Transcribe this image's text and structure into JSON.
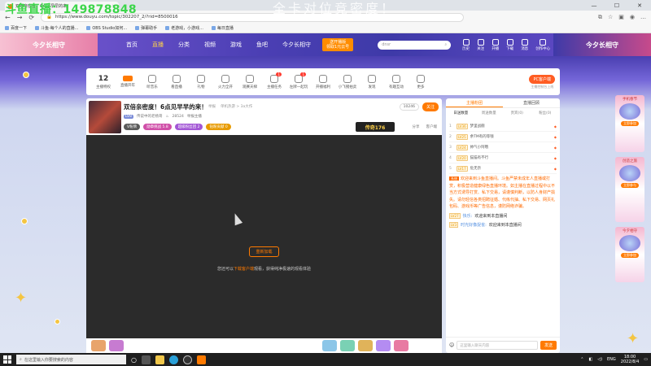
{
  "overlay": {
    "watermark": "斗鱼直播：149878848",
    "title": "全卡对位竞密度！"
  },
  "browser": {
    "tab_title": "双倍亲密度！6点见早早的来！",
    "tab_close": "×",
    "url": "https://www.douyu.com/topic/302207_2/?rid=8500016",
    "nav": {
      "back": "←",
      "forward": "→",
      "reload": "⟳"
    },
    "window_controls": [
      "—",
      "☐",
      "✕"
    ],
    "bookmarks": [
      "百度一下",
      "斗鱼·每个人的直播...",
      "OBS Studio如何...",
      "弹幕助手",
      "老游戏，小游戏...",
      "每日直播"
    ]
  },
  "header": {
    "logo": "今夕长相守",
    "nav": [
      "首页",
      "直播",
      "分类",
      "视频",
      "游戏",
      "鱼吧",
      "今夕长相守"
    ],
    "active_index": 1,
    "download_btn": "送开播版\n领取1元云号",
    "search_placeholder": "dnsr",
    "icons": [
      "历史",
      "关注",
      "开播",
      "下载",
      "消息",
      "创作中心"
    ],
    "banner": "今夕长相守"
  },
  "categories": {
    "count": "12",
    "items": [
      {
        "label": "主播特权",
        "badge": ""
      },
      {
        "label": "直播开年",
        "badge": ""
      },
      {
        "label": "听音乐",
        "badge": ""
      },
      {
        "label": "看直播",
        "badge": ""
      },
      {
        "label": "礼物",
        "badge": ""
      },
      {
        "label": "火力全开",
        "badge": ""
      },
      {
        "label": "观赛天梯",
        "badge": ""
      },
      {
        "label": "主播任务",
        "badge": "1"
      },
      {
        "label": "左牌一起玩",
        "badge": "1"
      },
      {
        "label": "开播福利",
        "badge": ""
      },
      {
        "label": "小飞猪拍卖",
        "badge": ""
      },
      {
        "label": "发现",
        "badge": ""
      },
      {
        "label": "有趣互动",
        "badge": ""
      },
      {
        "label": "更多",
        "badge": ""
      }
    ],
    "pc_button": "PC客户端",
    "pc_sub": "主播控制台上线"
  },
  "room": {
    "title": "双倍亲密度！6点见早早的来！",
    "tags": [
      "举报",
      "单机热游 > 3a大作"
    ],
    "level": "LV8",
    "anchor": "传说中的老杨哥",
    "heat": "28524",
    "report": "举报主播",
    "pills": [
      {
        "text": "V粉牌",
        "color": "#5a5a5a"
      },
      {
        "text": "勋章挑战 5.8",
        "color": "#d04fa8"
      },
      {
        "text": "超级粉丝团 2",
        "color": "#a357d6"
      },
      {
        "text": "钻粉贡献 0",
        "color": "#e89b00"
      }
    ],
    "follow_count": "10246",
    "follow": "关注",
    "game_badge": "传奇176",
    "actions": [
      "分享",
      "客户端"
    ]
  },
  "player": {
    "reload": "重新加载",
    "tip_prefix": "您还可以",
    "tip_link": "下载客户端",
    "tip_suffix": "观看，获得纯净极速的观看体验"
  },
  "side": {
    "tabs": [
      "主播粉团",
      "直播回顾"
    ],
    "subtabs": [
      "日送数量",
      "周送数量",
      "贵宾(0)",
      "粉丝(0)"
    ],
    "rank": [
      {
        "idx": "1",
        "lv": "LV36",
        "name": "梦里战舰"
      },
      {
        "idx": "2",
        "lv": "LV25",
        "name": "余TM有的等钱"
      },
      {
        "idx": "3",
        "lv": "LV24",
        "name": "帅气小阿哦"
      },
      {
        "idx": "4",
        "lv": "LV20",
        "name": "猫猫有不行"
      },
      {
        "idx": "5",
        "lv": "LV17",
        "name": "危无奈"
      }
    ],
    "system": "系统",
    "notice": "欢迎来到斗鱼直播间。斗鱼严禁未成年人直播或打赏，积极营造健康绿色直播环境。如主播在直播过程中以不当方式诱导打赏、私下交易，请谨慎判断，以防人身财产损失。请勿轻信各类招聘征婚、代练代抽、私下交易、网页礼包码、游戏币等广告信息，谨防网络诈骗。",
    "messages": [
      {
        "lv": "LV27",
        "name": "快乐:",
        "text": "欢迎来到本直播间"
      },
      {
        "lv": "LV3",
        "name": "时光好像捉雀:",
        "text": "欢迎来到本直播间"
      }
    ],
    "input_placeholder": "这里输入聊天内容",
    "send": "发送"
  },
  "ads": [
    "手机春节",
    "创造之旅",
    "今夕相守"
  ],
  "ad_btns": [
    "立即参加",
    "立即参与",
    "立即参加"
  ],
  "taskbar": {
    "search": "在这里输入你要搜索的内容",
    "lang": "ENG",
    "time": "18:00",
    "date": "2022/8/4"
  }
}
